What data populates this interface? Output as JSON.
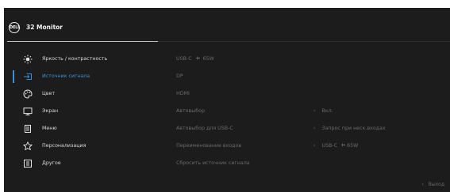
{
  "header": {
    "logo_text": "DELL",
    "title": "32 Monitor"
  },
  "menu": [
    {
      "label": "Яркость / контрастность",
      "icon": "brightness-icon"
    },
    {
      "label": "Источник сигнала",
      "icon": "input-source-icon",
      "active": true
    },
    {
      "label": "Цвет",
      "icon": "color-icon"
    },
    {
      "label": "Экран",
      "icon": "display-icon"
    },
    {
      "label": "Меню",
      "icon": "menu-icon"
    },
    {
      "label": "Персонализация",
      "icon": "star-icon"
    },
    {
      "label": "Другое",
      "icon": "others-icon"
    }
  ],
  "sources": [
    {
      "label": "USB-C",
      "extra": "65W",
      "extra_icon": "power-plug-icon"
    },
    {
      "label": "DP"
    },
    {
      "label": "HDMI"
    },
    {
      "label": "Автовыбор"
    },
    {
      "label": "Автовыбор для USB-C"
    },
    {
      "label": "Переименование входов"
    },
    {
      "label": "Сбросить источник сигнала"
    }
  ],
  "values": {
    "auto_select": "Вкл.",
    "auto_select_usbc": "Запрос при неск.входах",
    "rename_usbc": "USB-C",
    "rename_extra": "65W"
  },
  "footer": {
    "exit_label": "Выход"
  },
  "colors": {
    "background": "#1c1c1c",
    "accent": "#3a8fd8",
    "text": "#d9d9d9",
    "dim_text": "#6a6a6a"
  }
}
